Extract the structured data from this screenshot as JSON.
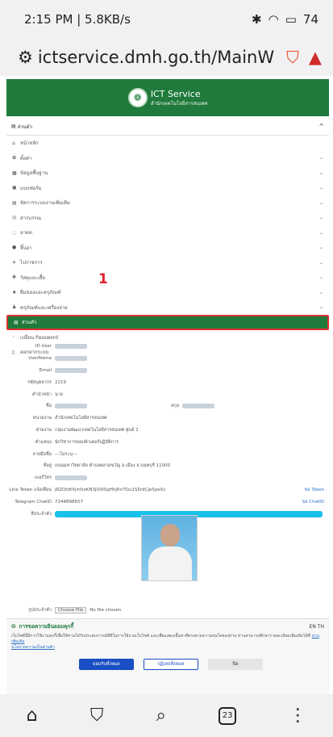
{
  "status": {
    "time": "2:15 PM | 5.8KB/s",
    "battery": "74"
  },
  "browser": {
    "url": "ictservice.dmh.go.th/MainW"
  },
  "header": {
    "title": "ICT Service",
    "subtitle": "สำนักเทคโนโลยีสารสนเทศ"
  },
  "menu": {
    "header": "ส่วนตัว",
    "items": [
      {
        "label": "หน้าหลัก",
        "icon": "home-icon",
        "glyph": "⌂",
        "chev": ""
      },
      {
        "label": "ตั้งค่า",
        "icon": "gear-icon",
        "glyph": "✿",
        "chev": "⌄"
      },
      {
        "label": "ข้อมูลพื้นฐาน",
        "icon": "database-icon",
        "glyph": "▦",
        "chev": "⌄"
      },
      {
        "label": "แบบฟอร์ม",
        "icon": "form-icon",
        "glyph": "▣",
        "chev": "⌄"
      },
      {
        "label": "จัดการระบบงานเพิ่มเติม",
        "icon": "apps-icon",
        "glyph": "▤",
        "chev": "⌄"
      },
      {
        "label": "สารบรรณ",
        "icon": "mail-icon",
        "glyph": "◎",
        "chev": "⌄"
      },
      {
        "label": "ลาดต",
        "icon": "leave-icon",
        "glyph": "◌",
        "chev": "⌄"
      },
      {
        "label": "จิ๊นอา",
        "icon": "globe-icon",
        "glyph": "●",
        "chev": "⌄"
      },
      {
        "label": "ไปราชการ",
        "icon": "plane-icon",
        "glyph": "✈",
        "chev": "⌄"
      },
      {
        "label": "วัสดุและเสื้อ",
        "icon": "box-icon",
        "glyph": "✤",
        "chev": "⌄"
      },
      {
        "label": "ยืมของและครุภัณฑ์",
        "icon": "tag-icon",
        "glyph": "♦",
        "chev": "⌄"
      },
      {
        "label": "ครุภัณฑ์และเครื่องจ่าย",
        "icon": "users-icon",
        "glyph": "♟",
        "chev": "⌄"
      },
      {
        "label": "ส่วนตัว",
        "icon": "id-card-icon",
        "glyph": "▤",
        "chev": "",
        "active": true
      },
      {
        "label": "เปลี่ยน Password",
        "icon": "key-icon",
        "glyph": "◦",
        "chev": ""
      },
      {
        "label": "ออกจากระบบ",
        "icon": "logout-icon",
        "glyph": "▯",
        "chev": ""
      }
    ]
  },
  "annotation": "1",
  "form": {
    "rows": [
      {
        "label": "ID User",
        "value": ""
      },
      {
        "label": "UserName",
        "value": ""
      },
      {
        "label": "Email",
        "value": ""
      },
      {
        "label": "รหัสบุคลากร",
        "value": "2219"
      },
      {
        "label": "คำนำหน้า",
        "value": "นาย"
      },
      {
        "label": "ชื่อ",
        "value": "",
        "extra": "สกุล"
      },
      {
        "label": "หน่วยงาน",
        "value": "สำนักเทคโนโลยีสารสนเทศ"
      },
      {
        "label": "ฝ่ายงาน",
        "value": "กลุ่มงานพัฒนาเทคโนโลยีสารสนเทศ ศูนย์ 2"
      },
      {
        "label": "ตำแหน่ง",
        "value": "นักวิชาการคอมพิวเตอร์ปฏิบัติการ"
      },
      {
        "label": "ลายมือชื่อ",
        "value": "---ไม่ระบุ---"
      },
      {
        "label": "ที่อยู่",
        "value": "ถนนมหาวิทยาลัย ตำบลตลาดขวัญ อ.เมือง จ.นนทบุรี 11000"
      },
      {
        "label": "เบอร์โทร",
        "value": ""
      },
      {
        "label": "Line Token แจ้งเตือน",
        "value": "jRZQtdtXjm5oKN3JU0ISqHhjRnTOu1S5rdCJeSyeXc",
        "link": "ขอ Token"
      },
      {
        "label": "Telegram ChatID",
        "value": "7244898657",
        "link": "ขอ ChatID"
      },
      {
        "label": "สีประจำตัว",
        "value": ""
      }
    ],
    "upload_label": "รูปประจำตัว",
    "upload_btn": "Choose File",
    "upload_status": "No file chosen"
  },
  "consent": {
    "title": "การขอความยินยอมคุกกี้",
    "lang": "EN TH",
    "text": "เว็บไซต์นี้มีการใช้งานคุกกี้เพื่อให้ท่านได้รับประสบการณ์ที่ดีในการใช้งานเว็บไซต์ และเพื่อแสดงเนื้อหาที่ตรงตามความสนใจของท่าน ท่านสามารถศึกษารายละเอียดเพิ่มเติมได้ที่",
    "read_more": "อ่านเพิ่มเติม",
    "policy": "นโยบายความเป็นส่วนตัว",
    "accept": "ยอมรับทั้งหมด",
    "reject": "ปฏิเสธทั้งหมด",
    "close": "ปิด"
  }
}
